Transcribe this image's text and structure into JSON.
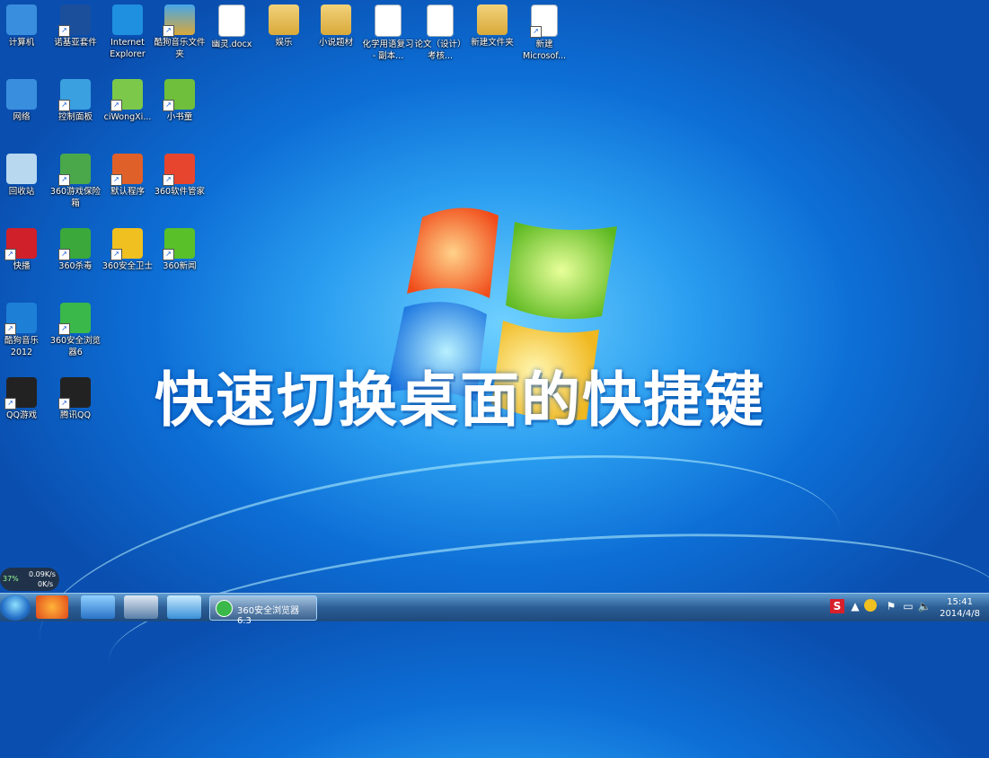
{
  "desktop": {
    "title": "快速切换桌面的快捷键",
    "icons": [
      {
        "label": "计算机",
        "icon": "computer-icon",
        "color": "#3a8ede"
      },
      {
        "label": "诺基亚套件",
        "icon": "nokia-suite-icon",
        "color": "#1b4f9c"
      },
      {
        "label": "Internet Explorer",
        "icon": "ie-icon",
        "color": "#1f8fe0"
      },
      {
        "label": "酷狗音乐文件夹",
        "icon": "kugou-folder-icon",
        "color": "#46a6e8"
      },
      {
        "label": "幽灵.docx",
        "icon": "word-doc-icon",
        "color": "#ffffff"
      },
      {
        "label": "娱乐",
        "icon": "folder-icon",
        "color": "#f2d27a"
      },
      {
        "label": "小说题材",
        "icon": "folder-icon",
        "color": "#f2d27a"
      },
      {
        "label": "化学用语复习 - 副本...",
        "icon": "document-icon",
        "color": "#ffffff"
      },
      {
        "label": "论文（设计）考核...",
        "icon": "word-doc-icon",
        "color": "#ffffff"
      },
      {
        "label": "新建文件夹",
        "icon": "folder-icon",
        "color": "#f2d27a"
      },
      {
        "label": "新建 Microsof...",
        "icon": "word-doc-icon",
        "color": "#ffffff"
      },
      {
        "label": "网络",
        "icon": "network-icon",
        "color": "#3a8ede"
      },
      {
        "label": "控制面板",
        "icon": "control-panel-icon",
        "color": "#3aa0e0"
      },
      {
        "label": "ciWongXi...",
        "icon": "ciwong-icon",
        "color": "#7cc84a"
      },
      {
        "label": "小书童",
        "icon": "xiaoshutong-icon",
        "color": "#6fbf3c"
      },
      {
        "label": "回收站",
        "icon": "recycle-bin-icon",
        "color": "#b8d8f0"
      },
      {
        "label": "360游戏保险箱",
        "icon": "360-game-safe-icon",
        "color": "#4aa84a"
      },
      {
        "label": "默认程序",
        "icon": "default-programs-icon",
        "color": "#e0602a"
      },
      {
        "label": "360软件管家",
        "icon": "360-software-manager-icon",
        "color": "#e8452e"
      },
      {
        "label": "快播",
        "icon": "qvod-icon",
        "color": "#d0202a"
      },
      {
        "label": "360杀毒",
        "icon": "360-antivirus-icon",
        "color": "#3aa83a"
      },
      {
        "label": "360安全卫士",
        "icon": "360-safeguard-icon",
        "color": "#f0c020"
      },
      {
        "label": "360新闻",
        "icon": "360-news-icon",
        "color": "#5ac02a"
      },
      {
        "label": "酷狗音乐2012",
        "icon": "kugou-icon",
        "color": "#1e7fd6"
      },
      {
        "label": "360安全浏览器6",
        "icon": "360-browser-icon",
        "color": "#3ab84a"
      },
      {
        "label": "QQ游戏",
        "icon": "qq-game-icon",
        "color": "#222222"
      },
      {
        "label": "腾讯QQ",
        "icon": "qq-icon",
        "color": "#222222"
      }
    ]
  },
  "widget": {
    "percent": "37%",
    "up": "0.09K/s",
    "down": "0K/s"
  },
  "taskbar": {
    "task_label": "360安全浏览器 6.3",
    "clock_time": "15:41",
    "clock_date": "2014/4/8"
  }
}
